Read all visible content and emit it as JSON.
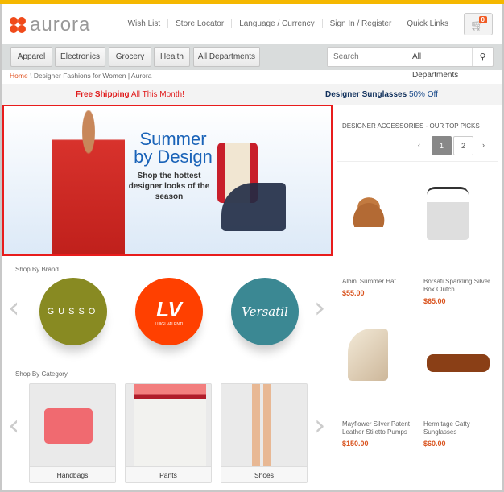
{
  "header": {
    "logo": "aurora",
    "links": [
      "Wish List",
      "Store Locator",
      "Language / Currency",
      "Sign In / Register",
      "Quick Links"
    ],
    "cart_count": "0"
  },
  "nav": {
    "items": [
      "Apparel",
      "Electronics",
      "Grocery",
      "Health",
      "All Departments"
    ],
    "search_placeholder": "Search",
    "search_scope": "All Departments"
  },
  "breadcrumb": {
    "home": "Home",
    "current": "Designer Fashions for Women | Aurora"
  },
  "promo": {
    "left_bold": "Free Shipping",
    "left_rest": "All This Month!",
    "right_bold": "Designer Sunglasses",
    "right_rest": "50% Off"
  },
  "hero": {
    "title_1": "Summer",
    "title_2": "by Design",
    "subtitle": "Shop the hottest designer looks of the season"
  },
  "brands": {
    "title": "Shop By Brand",
    "items": [
      {
        "name": "GUSSO",
        "color": "#888a22"
      },
      {
        "name": "LV",
        "sub": "LUIGI VALENTI",
        "color": "#ff4000"
      },
      {
        "name": "Versatil",
        "color": "#3b8893"
      }
    ]
  },
  "categories": {
    "title": "Shop By Category",
    "items": [
      "Handbags",
      "Pants",
      "Shoes"
    ]
  },
  "picks": {
    "title": "DESIGNER ACCESSORIES - OUR TOP PICKS",
    "pages": [
      "1",
      "2"
    ],
    "active_page": "1",
    "products": [
      {
        "name": "Albini Summer Hat",
        "price": "$55.00"
      },
      {
        "name": "Borsati Sparkling Silver Box Clutch",
        "price": "$65.00"
      },
      {
        "name": "Mayflower Silver Patent Leather Stiletto Pumps",
        "price": "$150.00"
      },
      {
        "name": "Hermitage Catty Sunglasses",
        "price": "$60.00"
      }
    ]
  },
  "colors": {
    "accent": "#f15a22",
    "top_bar": "#f5b800",
    "hero_border": "#e81c1c",
    "price": "#d9531e"
  }
}
